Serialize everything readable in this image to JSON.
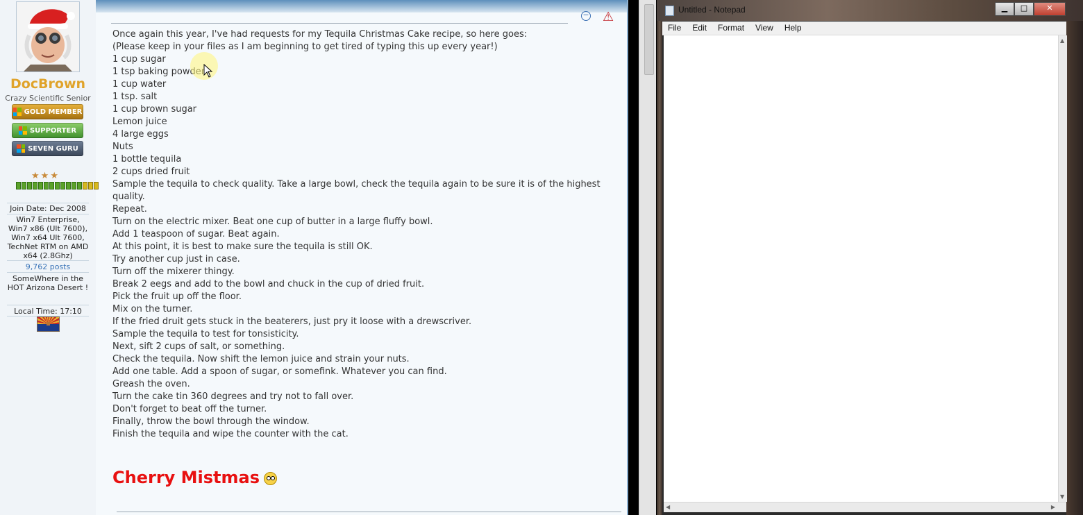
{
  "forum": {
    "user": {
      "name": "DocBrown",
      "title": "Crazy Scientific Senior",
      "badges": [
        "GOLD MEMBER",
        "SUPPORTER",
        "SEVEN GURU"
      ],
      "join_date": "Join Date: Dec 2008",
      "system": "Win7 Enterprise, Win7 x86 (Ult 7600), Win7 x64 Ult 7600, TechNet RTM on AMD x64 (2.8Ghz)",
      "posts": "9,762 posts",
      "location": "SomeWhere in the HOT Arizona Desert !",
      "local_time": "Local Time: 17:10"
    },
    "post_lines": [
      "Once again this year, I've had requests for my Tequila Christmas Cake recipe, so here goes:",
      "(Please keep in your files as I am beginning to get tired of typing this up every year!)",
      "1 cup sugar",
      "1 tsp baking powder",
      "1 cup water",
      "1 tsp. salt",
      "1 cup brown sugar",
      "Lemon juice",
      "4 large eggs",
      "Nuts",
      "1 bottle tequila",
      "2 cups dried fruit",
      "Sample the tequila to check quality. Take a large bowl, check the tequila again to be sure it is of the highest quality.",
      "Repeat.",
      "Turn on the electric mixer. Beat one cup of butter in a large fluffy bowl.",
      "Add 1 teaspoon of sugar. Beat again.",
      "At this point, it is best to make sure the tequila is still OK.",
      "Try another cup just in case.",
      "Turn off the mixerer thingy.",
      "Break 2 eegs and add to the bowl and chuck in the cup of dried fruit.",
      "Pick the fruit up off the floor.",
      "Mix on the turner.",
      "If the fried druit gets stuck in the beaterers, just pry it loose with a drewscriver.",
      "Sample the tequila to test for tonsisticity.",
      "Next, sift 2 cups of salt, or something.",
      "Check the tequila. Now shift the lemon juice and strain your nuts.",
      "Add one table. Add a spoon of sugar, or somefink. Whatever you can find.",
      "Greash the oven.",
      "Turn the cake tin 360 degrees and try not to fall over.",
      "Don't forget to beat off the turner.",
      "Finally, throw the bowl through the window.",
      "Finish the tequila and wipe the counter with the cat."
    ],
    "signature": "Cherry Mistmas"
  },
  "notepad": {
    "title": "Untitled - Notepad",
    "menu": [
      "File",
      "Edit",
      "Format",
      "View",
      "Help"
    ],
    "content": ""
  }
}
